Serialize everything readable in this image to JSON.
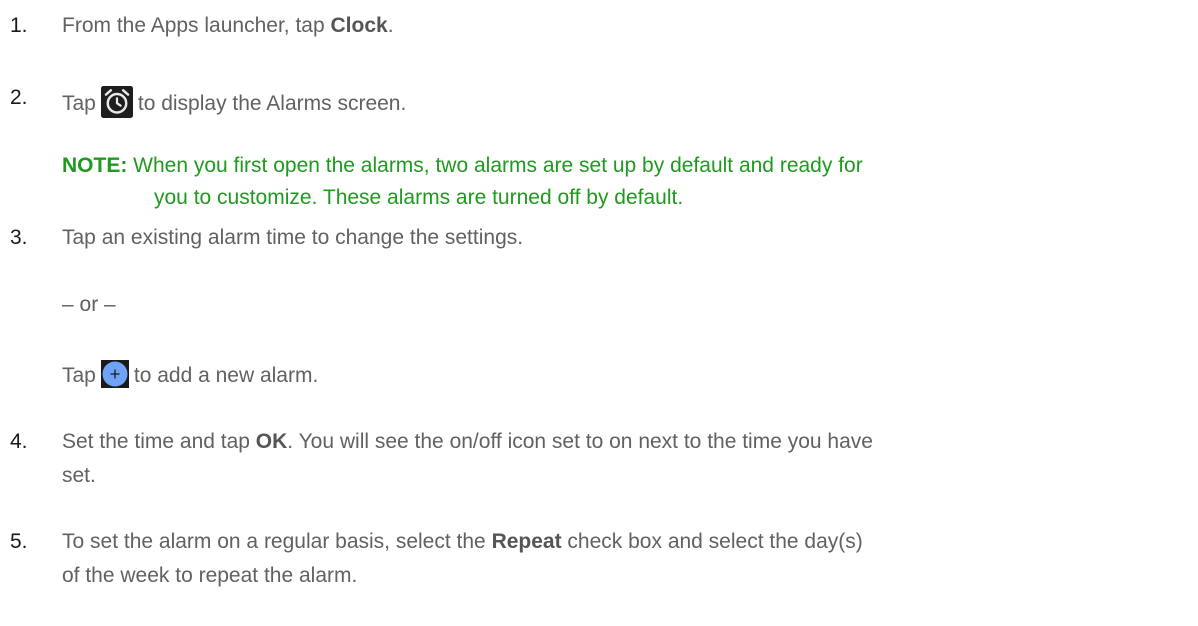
{
  "steps": [
    {
      "num": "1.",
      "pre": "From the Apps launcher, tap ",
      "bold": "Clock",
      "post": "."
    },
    {
      "num": "2.",
      "pre": "Tap",
      "post": "to display the Alarms screen.",
      "icon": "alarm-clock-icon"
    },
    {
      "num": "3.",
      "text": "Tap an existing alarm time to change the settings.",
      "or": "– or –",
      "alt_pre": "Tap",
      "alt_post": "to add a new alarm.",
      "alt_icon": "add-plus-icon"
    },
    {
      "num": "4.",
      "pre": "Set the time and tap ",
      "bold": "OK",
      "post": ". You will see the on/off icon set to on next to the time you have",
      "line2": "set."
    },
    {
      "num": "5.",
      "pre": "To set the alarm on a regular basis, select the ",
      "bold": "Repeat",
      "post": " check box and select the day(s)",
      "line2": "of the week to repeat the alarm."
    }
  ],
  "note": {
    "label": "NOTE:",
    "line1": " When you first open the alarms, two alarms are set up by default and ready for",
    "line2": "you to customize. These alarms are turned off by default."
  },
  "colors": {
    "note": "#1f9a1f",
    "text": "#616161",
    "add_button": "#6ea3f5"
  }
}
